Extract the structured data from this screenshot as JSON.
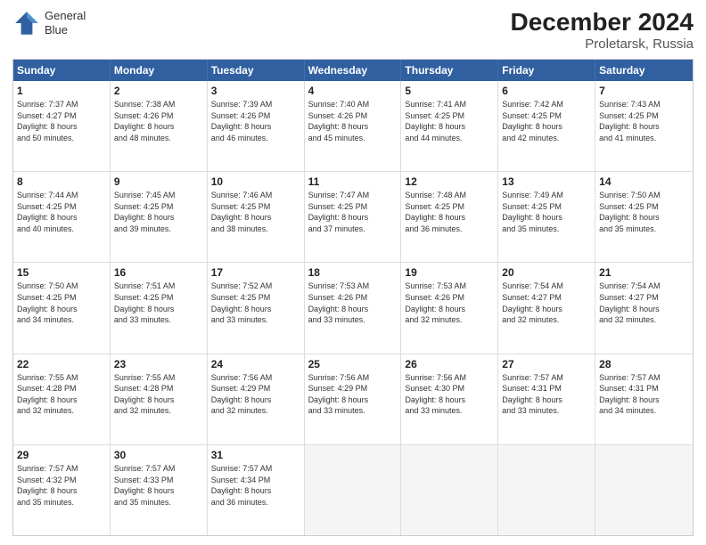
{
  "header": {
    "logo_line1": "General",
    "logo_line2": "Blue",
    "title": "December 2024",
    "subtitle": "Proletarsk, Russia"
  },
  "days": [
    "Sunday",
    "Monday",
    "Tuesday",
    "Wednesday",
    "Thursday",
    "Friday",
    "Saturday"
  ],
  "rows": [
    [
      {
        "day": "1",
        "info": "Sunrise: 7:37 AM\nSunset: 4:27 PM\nDaylight: 8 hours\nand 50 minutes."
      },
      {
        "day": "2",
        "info": "Sunrise: 7:38 AM\nSunset: 4:26 PM\nDaylight: 8 hours\nand 48 minutes."
      },
      {
        "day": "3",
        "info": "Sunrise: 7:39 AM\nSunset: 4:26 PM\nDaylight: 8 hours\nand 46 minutes."
      },
      {
        "day": "4",
        "info": "Sunrise: 7:40 AM\nSunset: 4:26 PM\nDaylight: 8 hours\nand 45 minutes."
      },
      {
        "day": "5",
        "info": "Sunrise: 7:41 AM\nSunset: 4:25 PM\nDaylight: 8 hours\nand 44 minutes."
      },
      {
        "day": "6",
        "info": "Sunrise: 7:42 AM\nSunset: 4:25 PM\nDaylight: 8 hours\nand 42 minutes."
      },
      {
        "day": "7",
        "info": "Sunrise: 7:43 AM\nSunset: 4:25 PM\nDaylight: 8 hours\nand 41 minutes."
      }
    ],
    [
      {
        "day": "8",
        "info": "Sunrise: 7:44 AM\nSunset: 4:25 PM\nDaylight: 8 hours\nand 40 minutes."
      },
      {
        "day": "9",
        "info": "Sunrise: 7:45 AM\nSunset: 4:25 PM\nDaylight: 8 hours\nand 39 minutes."
      },
      {
        "day": "10",
        "info": "Sunrise: 7:46 AM\nSunset: 4:25 PM\nDaylight: 8 hours\nand 38 minutes."
      },
      {
        "day": "11",
        "info": "Sunrise: 7:47 AM\nSunset: 4:25 PM\nDaylight: 8 hours\nand 37 minutes."
      },
      {
        "day": "12",
        "info": "Sunrise: 7:48 AM\nSunset: 4:25 PM\nDaylight: 8 hours\nand 36 minutes."
      },
      {
        "day": "13",
        "info": "Sunrise: 7:49 AM\nSunset: 4:25 PM\nDaylight: 8 hours\nand 35 minutes."
      },
      {
        "day": "14",
        "info": "Sunrise: 7:50 AM\nSunset: 4:25 PM\nDaylight: 8 hours\nand 35 minutes."
      }
    ],
    [
      {
        "day": "15",
        "info": "Sunrise: 7:50 AM\nSunset: 4:25 PM\nDaylight: 8 hours\nand 34 minutes."
      },
      {
        "day": "16",
        "info": "Sunrise: 7:51 AM\nSunset: 4:25 PM\nDaylight: 8 hours\nand 33 minutes."
      },
      {
        "day": "17",
        "info": "Sunrise: 7:52 AM\nSunset: 4:25 PM\nDaylight: 8 hours\nand 33 minutes."
      },
      {
        "day": "18",
        "info": "Sunrise: 7:53 AM\nSunset: 4:26 PM\nDaylight: 8 hours\nand 33 minutes."
      },
      {
        "day": "19",
        "info": "Sunrise: 7:53 AM\nSunset: 4:26 PM\nDaylight: 8 hours\nand 32 minutes."
      },
      {
        "day": "20",
        "info": "Sunrise: 7:54 AM\nSunset: 4:27 PM\nDaylight: 8 hours\nand 32 minutes."
      },
      {
        "day": "21",
        "info": "Sunrise: 7:54 AM\nSunset: 4:27 PM\nDaylight: 8 hours\nand 32 minutes."
      }
    ],
    [
      {
        "day": "22",
        "info": "Sunrise: 7:55 AM\nSunset: 4:28 PM\nDaylight: 8 hours\nand 32 minutes."
      },
      {
        "day": "23",
        "info": "Sunrise: 7:55 AM\nSunset: 4:28 PM\nDaylight: 8 hours\nand 32 minutes."
      },
      {
        "day": "24",
        "info": "Sunrise: 7:56 AM\nSunset: 4:29 PM\nDaylight: 8 hours\nand 32 minutes."
      },
      {
        "day": "25",
        "info": "Sunrise: 7:56 AM\nSunset: 4:29 PM\nDaylight: 8 hours\nand 33 minutes."
      },
      {
        "day": "26",
        "info": "Sunrise: 7:56 AM\nSunset: 4:30 PM\nDaylight: 8 hours\nand 33 minutes."
      },
      {
        "day": "27",
        "info": "Sunrise: 7:57 AM\nSunset: 4:31 PM\nDaylight: 8 hours\nand 33 minutes."
      },
      {
        "day": "28",
        "info": "Sunrise: 7:57 AM\nSunset: 4:31 PM\nDaylight: 8 hours\nand 34 minutes."
      }
    ],
    [
      {
        "day": "29",
        "info": "Sunrise: 7:57 AM\nSunset: 4:32 PM\nDaylight: 8 hours\nand 35 minutes."
      },
      {
        "day": "30",
        "info": "Sunrise: 7:57 AM\nSunset: 4:33 PM\nDaylight: 8 hours\nand 35 minutes."
      },
      {
        "day": "31",
        "info": "Sunrise: 7:57 AM\nSunset: 4:34 PM\nDaylight: 8 hours\nand 36 minutes."
      },
      {
        "day": "",
        "info": ""
      },
      {
        "day": "",
        "info": ""
      },
      {
        "day": "",
        "info": ""
      },
      {
        "day": "",
        "info": ""
      }
    ]
  ]
}
